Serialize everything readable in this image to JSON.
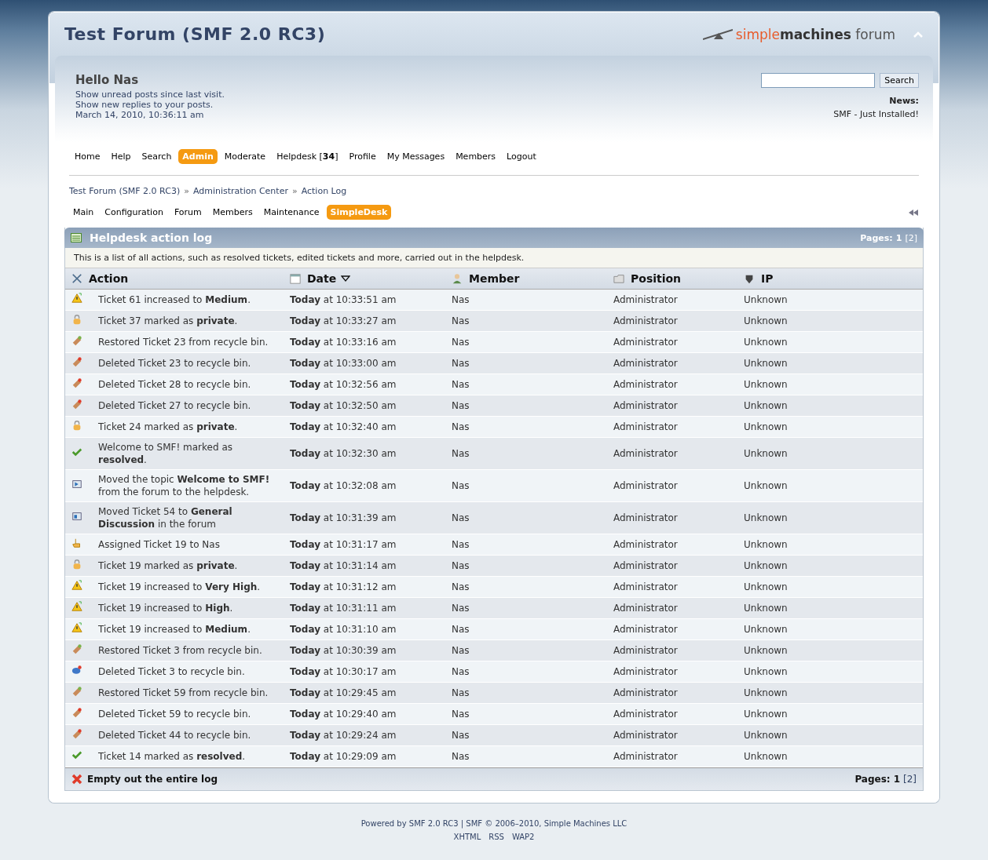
{
  "header": {
    "title": "Test Forum (SMF 2.0 RC3)",
    "logo": {
      "first": "simple",
      "second": "machines",
      "third": "forum"
    }
  },
  "user": {
    "greeting": "Hello Nas",
    "links": [
      "Show unread posts since last visit.",
      "Show new replies to your posts."
    ],
    "date": "March 14, 2010, 10:36:11 am"
  },
  "search": {
    "button": "Search"
  },
  "news": {
    "label": "News:",
    "text": "SMF - Just Installed!"
  },
  "menu": [
    {
      "label": "Home",
      "selected": false
    },
    {
      "label": "Help",
      "selected": false
    },
    {
      "label": "Search",
      "selected": false
    },
    {
      "label": "Admin",
      "selected": true
    },
    {
      "label": "Moderate",
      "selected": false
    },
    {
      "label": "Helpdesk [**34**]",
      "selected": false
    },
    {
      "label": "Profile",
      "selected": false
    },
    {
      "label": "My Messages",
      "selected": false
    },
    {
      "label": "Members",
      "selected": false
    },
    {
      "label": "Logout",
      "selected": false
    }
  ],
  "breadcrumb": {
    "separator": "»",
    "items": [
      "Test Forum (SMF 2.0 RC3)",
      "Administration Center",
      "Action Log"
    ]
  },
  "admin_tabs": [
    {
      "label": "Main",
      "selected": false
    },
    {
      "label": "Configuration",
      "selected": false
    },
    {
      "label": "Forum",
      "selected": false
    },
    {
      "label": "Members",
      "selected": false
    },
    {
      "label": "Maintenance",
      "selected": false
    },
    {
      "label": "SimpleDesk",
      "selected": true
    }
  ],
  "log": {
    "title": "Helpdesk action log",
    "pages_label": "Pages:",
    "pages": [
      {
        "label": "1",
        "selected": true
      },
      {
        "label": "[2]",
        "selected": false
      }
    ],
    "description": "This is a list of all actions, such as resolved tickets, edited tickets and more, carried out in the helpdesk.",
    "columns": [
      {
        "kind": "action",
        "label": "Action",
        "sorted": false
      },
      {
        "kind": "date",
        "label": "Date",
        "sorted": true
      },
      {
        "kind": "member",
        "label": "Member",
        "sorted": false
      },
      {
        "kind": "position",
        "label": "Position",
        "sorted": false
      },
      {
        "kind": "ip",
        "label": "IP",
        "sorted": false
      }
    ],
    "rows": [
      {
        "kind": "priority",
        "action": "Ticket 61 increased to **Medium**.",
        "date": "**Today** at 10:33:51 am",
        "member": "Nas",
        "position": "Administrator",
        "ip": "Unknown"
      },
      {
        "kind": "private",
        "action": "Ticket 37 marked as **private**.",
        "date": "**Today** at 10:33:27 am",
        "member": "Nas",
        "position": "Administrator",
        "ip": "Unknown"
      },
      {
        "kind": "restore",
        "action": "Restored Ticket 23 from recycle bin.",
        "date": "**Today** at 10:33:16 am",
        "member": "Nas",
        "position": "Administrator",
        "ip": "Unknown"
      },
      {
        "kind": "delete",
        "action": "Deleted Ticket 23 to recycle bin.",
        "date": "**Today** at 10:33:00 am",
        "member": "Nas",
        "position": "Administrator",
        "ip": "Unknown"
      },
      {
        "kind": "delete",
        "action": "Deleted Ticket 28 to recycle bin.",
        "date": "**Today** at 10:32:56 am",
        "member": "Nas",
        "position": "Administrator",
        "ip": "Unknown"
      },
      {
        "kind": "delete",
        "action": "Deleted Ticket 27 to recycle bin.",
        "date": "**Today** at 10:32:50 am",
        "member": "Nas",
        "position": "Administrator",
        "ip": "Unknown"
      },
      {
        "kind": "private",
        "action": "Ticket 24 marked as **private**.",
        "date": "**Today** at 10:32:40 am",
        "member": "Nas",
        "position": "Administrator",
        "ip": "Unknown"
      },
      {
        "kind": "resolved",
        "action": "Welcome to SMF! marked as **resolved**.",
        "date": "**Today** at 10:32:30 am",
        "member": "Nas",
        "position": "Administrator",
        "ip": "Unknown"
      },
      {
        "kind": "move_in",
        "action": "Moved the topic **Welcome to SMF!** from the forum to the helpdesk.",
        "date": "**Today** at 10:32:08 am",
        "member": "Nas",
        "position": "Administrator",
        "ip": "Unknown"
      },
      {
        "kind": "move_out",
        "action": "Moved Ticket 54 to **General Discussion** in the forum",
        "date": "**Today** at 10:31:39 am",
        "member": "Nas",
        "position": "Administrator",
        "ip": "Unknown"
      },
      {
        "kind": "assign",
        "action": "Assigned Ticket 19 to Nas",
        "date": "**Today** at 10:31:17 am",
        "member": "Nas",
        "position": "Administrator",
        "ip": "Unknown"
      },
      {
        "kind": "private",
        "action": "Ticket 19 marked as **private**.",
        "date": "**Today** at 10:31:14 am",
        "member": "Nas",
        "position": "Administrator",
        "ip": "Unknown"
      },
      {
        "kind": "priority",
        "action": "Ticket 19 increased to **Very High**.",
        "date": "**Today** at 10:31:12 am",
        "member": "Nas",
        "position": "Administrator",
        "ip": "Unknown"
      },
      {
        "kind": "priority",
        "action": "Ticket 19 increased to **High**.",
        "date": "**Today** at 10:31:11 am",
        "member": "Nas",
        "position": "Administrator",
        "ip": "Unknown"
      },
      {
        "kind": "priority",
        "action": "Ticket 19 increased to **Medium**.",
        "date": "**Today** at 10:31:10 am",
        "member": "Nas",
        "position": "Administrator",
        "ip": "Unknown"
      },
      {
        "kind": "restore",
        "action": "Restored Ticket 3 from recycle bin.",
        "date": "**Today** at 10:30:39 am",
        "member": "Nas",
        "position": "Administrator",
        "ip": "Unknown"
      },
      {
        "kind": "delete_reply",
        "action": "Deleted Ticket 3 to recycle bin.",
        "date": "**Today** at 10:30:17 am",
        "member": "Nas",
        "position": "Administrator",
        "ip": "Unknown"
      },
      {
        "kind": "restore",
        "action": "Restored Ticket 59 from recycle bin.",
        "date": "**Today** at 10:29:45 am",
        "member": "Nas",
        "position": "Administrator",
        "ip": "Unknown"
      },
      {
        "kind": "delete",
        "action": "Deleted Ticket 59 to recycle bin.",
        "date": "**Today** at 10:29:40 am",
        "member": "Nas",
        "position": "Administrator",
        "ip": "Unknown"
      },
      {
        "kind": "delete",
        "action": "Deleted Ticket 44 to recycle bin.",
        "date": "**Today** at 10:29:24 am",
        "member": "Nas",
        "position": "Administrator",
        "ip": "Unknown"
      },
      {
        "kind": "resolved",
        "action": "Ticket 14 marked as **resolved**.",
        "date": "**Today** at 10:29:09 am",
        "member": "Nas",
        "position": "Administrator",
        "ip": "Unknown"
      }
    ],
    "empty_link": "Empty out the entire log",
    "bottom_pages_label": "Pages:",
    "bottom_pages": [
      {
        "label": "1",
        "selected": true
      },
      {
        "label": "[2]",
        "selected": false
      }
    ]
  },
  "footer": {
    "powered": "Powered by SMF 2.0 RC3 | SMF © 2006–2010, Simple Machines LLC",
    "links": [
      "XHTML",
      "RSS",
      "WAP2"
    ]
  }
}
